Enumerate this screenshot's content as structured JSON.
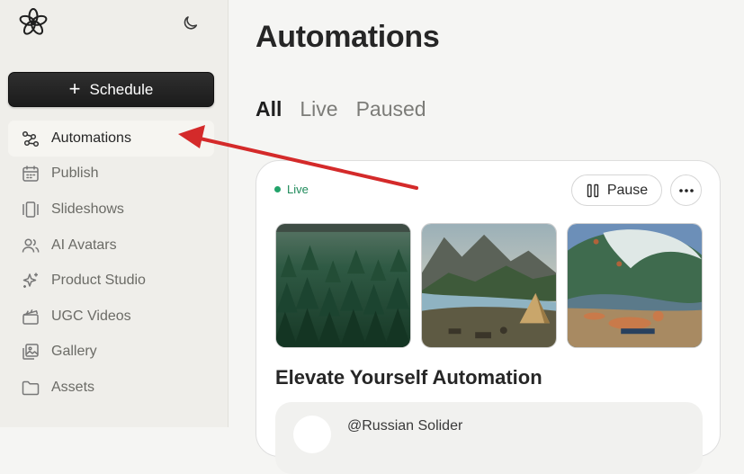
{
  "sidebar": {
    "schedule_label": "Schedule",
    "items": [
      {
        "label": "Automations",
        "icon": "workflow-icon",
        "active": true
      },
      {
        "label": "Publish",
        "icon": "calendar-icon"
      },
      {
        "label": "Slideshows",
        "icon": "slideshow-icon"
      },
      {
        "label": "AI Avatars",
        "icon": "users-icon"
      },
      {
        "label": "Product Studio",
        "icon": "sparkles-icon"
      },
      {
        "label": "UGC Videos",
        "icon": "clapperboard-icon"
      },
      {
        "label": "Gallery",
        "icon": "gallery-icon"
      },
      {
        "label": "Assets",
        "icon": "folder-icon"
      }
    ]
  },
  "main": {
    "title": "Automations",
    "tabs": [
      {
        "label": "All",
        "active": true
      },
      {
        "label": "Live"
      },
      {
        "label": "Paused"
      }
    ],
    "card": {
      "status": "Live",
      "pause_label": "Pause",
      "title": "Elevate Yourself Automation",
      "account": "@Russian Solider",
      "thumbnails": [
        "forest-image",
        "mountain-river-camp-image",
        "surfing-wave-image"
      ]
    }
  },
  "colors": {
    "live_green": "#22a36a",
    "annotation_arrow": "#d42a2a",
    "primary_button": "#1f1f1f"
  }
}
